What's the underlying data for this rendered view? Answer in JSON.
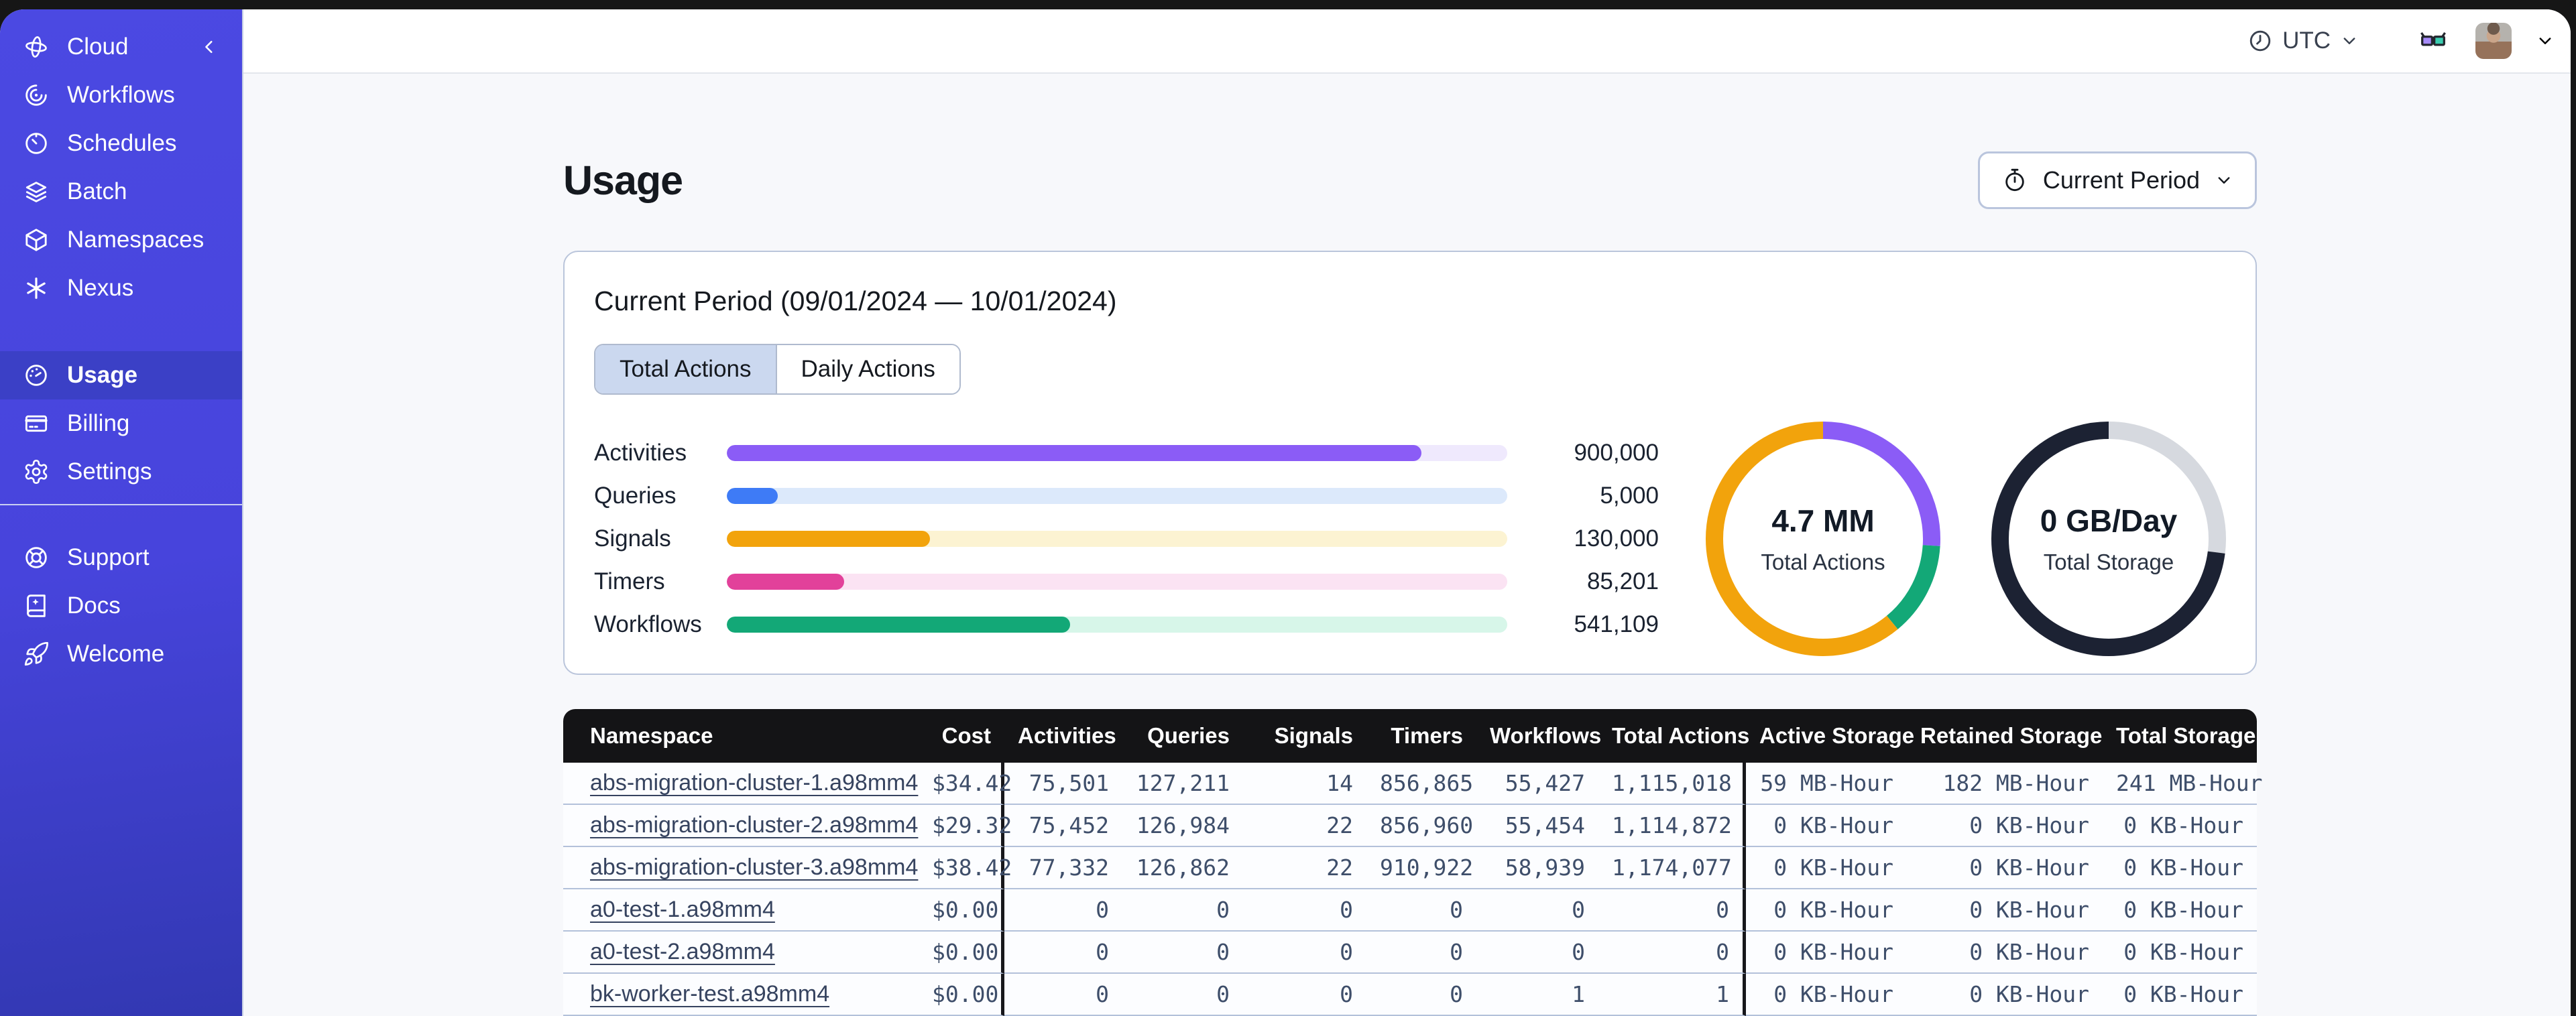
{
  "sidebar": {
    "header": {
      "label": "Cloud",
      "icon": "temporal-logo-icon",
      "collapse_icon": "chevron-left-icon"
    },
    "groups": [
      {
        "items": [
          {
            "label": "Workflows",
            "icon": "workflows-icon"
          },
          {
            "label": "Schedules",
            "icon": "schedules-icon"
          },
          {
            "label": "Batch",
            "icon": "batch-icon"
          },
          {
            "label": "Namespaces",
            "icon": "namespaces-icon"
          },
          {
            "label": "Nexus",
            "icon": "nexus-icon"
          }
        ]
      },
      {
        "items": [
          {
            "label": "Usage",
            "icon": "usage-icon",
            "active": true
          },
          {
            "label": "Billing",
            "icon": "billing-icon"
          },
          {
            "label": "Settings",
            "icon": "settings-icon"
          }
        ]
      },
      {
        "items": [
          {
            "label": "Support",
            "icon": "support-icon"
          },
          {
            "label": "Docs",
            "icon": "docs-icon"
          },
          {
            "label": "Welcome",
            "icon": "welcome-icon"
          }
        ]
      }
    ],
    "colors": {
      "base_top": "#4B49E2",
      "base_bottom": "#3238B2",
      "active_bg": "#3B40C6"
    }
  },
  "topbar": {
    "timezone": {
      "label": "UTC",
      "icon": "clock-icon"
    },
    "glasses_colors": {
      "left_lens": "#A78BFA",
      "right_lens": "#3BCDB0"
    }
  },
  "page": {
    "title": "Usage",
    "period_selector": {
      "label": "Current Period",
      "icon": "stopwatch-icon"
    }
  },
  "usage_card": {
    "title": "Current Period (09/01/2024 — 10/01/2024)",
    "tabs": [
      {
        "label": "Total Actions",
        "active": true
      },
      {
        "label": "Daily Actions",
        "active": false
      }
    ]
  },
  "chart_data": [
    {
      "type": "bar",
      "orientation": "horizontal",
      "categories": [
        "Activities",
        "Queries",
        "Signals",
        "Timers",
        "Workflows"
      ],
      "values": [
        900000,
        5000,
        130000,
        85201,
        541109
      ],
      "value_labels": [
        "900,000",
        "5,000",
        "130,000",
        "85,201",
        "541,109"
      ],
      "fill_percents": [
        89,
        6.5,
        26,
        15,
        44
      ],
      "bar_colors": [
        "#8B5CF6",
        "#3E7BF6",
        "#F2A30C",
        "#E2419A",
        "#13A877"
      ],
      "track_colors": [
        "#EFE9FD",
        "#DCE9FB",
        "#FCF3D2",
        "#FBE3F3",
        "#D7F6E9"
      ]
    },
    {
      "type": "donut",
      "center_value": "4.7 MM",
      "center_label": "Total Actions",
      "segments": [
        {
          "name": "purple",
          "percent": 26,
          "color": "#8B5CF6"
        },
        {
          "name": "green",
          "percent": 13,
          "color": "#13A877"
        },
        {
          "name": "orange",
          "percent": 61,
          "color": "#F2A30C"
        }
      ]
    },
    {
      "type": "donut",
      "center_value": "0 GB/Day",
      "center_label": "Total Storage",
      "segments": [
        {
          "name": "gray",
          "percent": 27,
          "color": "#D6D9DF"
        },
        {
          "name": "navy",
          "percent": 73,
          "color": "#1C2233"
        }
      ]
    }
  ],
  "table": {
    "columns": [
      {
        "label": "Namespace",
        "align": "left"
      },
      {
        "label": "Cost",
        "align": "right",
        "group_end": true
      },
      {
        "label": "Activities",
        "align": "right"
      },
      {
        "label": "Queries",
        "align": "right"
      },
      {
        "label": "Signals",
        "align": "right"
      },
      {
        "label": "Timers",
        "align": "right"
      },
      {
        "label": "Workflows",
        "align": "right"
      },
      {
        "label": "Total Actions",
        "align": "right",
        "group_end": true
      },
      {
        "label": "Active Storage",
        "align": "right"
      },
      {
        "label": "Retained Storage",
        "align": "right"
      },
      {
        "label": "Total Storage",
        "align": "right"
      }
    ],
    "rows": [
      {
        "namespace": "abs-migration-cluster-1.a98mm4",
        "cells": [
          "$34.42",
          "75,501",
          "127,211",
          "14",
          "856,865",
          "55,427",
          "1,115,018",
          "59 MB-Hour",
          "182 MB-Hour",
          "241 MB-Hour"
        ]
      },
      {
        "namespace": "abs-migration-cluster-2.a98mm4",
        "cells": [
          "$29.32",
          "75,452",
          "126,984",
          "22",
          "856,960",
          "55,454",
          "1,114,872",
          "0 KB-Hour",
          "0 KB-Hour",
          "0 KB-Hour"
        ]
      },
      {
        "namespace": "abs-migration-cluster-3.a98mm4",
        "cells": [
          "$38.42",
          "77,332",
          "126,862",
          "22",
          "910,922",
          "58,939",
          "1,174,077",
          "0 KB-Hour",
          "0 KB-Hour",
          "0 KB-Hour"
        ]
      },
      {
        "namespace": "a0-test-1.a98mm4",
        "cells": [
          "$0.00",
          "0",
          "0",
          "0",
          "0",
          "0",
          "0",
          "0 KB-Hour",
          "0 KB-Hour",
          "0 KB-Hour"
        ]
      },
      {
        "namespace": "a0-test-2.a98mm4",
        "cells": [
          "$0.00",
          "0",
          "0",
          "0",
          "0",
          "0",
          "0",
          "0 KB-Hour",
          "0 KB-Hour",
          "0 KB-Hour"
        ]
      },
      {
        "namespace": "bk-worker-test.a98mm4",
        "cells": [
          "$0.00",
          "0",
          "0",
          "0",
          "0",
          "1",
          "1",
          "0 KB-Hour",
          "0 KB-Hour",
          "0 KB-Hour"
        ]
      }
    ]
  }
}
